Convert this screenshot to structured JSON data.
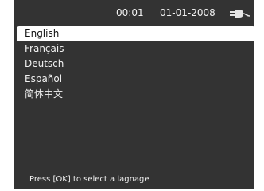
{
  "status": {
    "time": "00:01",
    "date": "01-01-2008",
    "power_icon": "plug-icon"
  },
  "languages": {
    "items": [
      {
        "label": "English",
        "selected": true
      },
      {
        "label": "Français",
        "selected": false
      },
      {
        "label": "Deutsch",
        "selected": false
      },
      {
        "label": "Español",
        "selected": false
      },
      {
        "label": "简体中文",
        "selected": false
      }
    ]
  },
  "footer": {
    "hint": "Press [OK] to select a lagnage"
  },
  "colors": {
    "background": "#333333",
    "text": "#f2f2f2",
    "selection": "#ffffff"
  }
}
